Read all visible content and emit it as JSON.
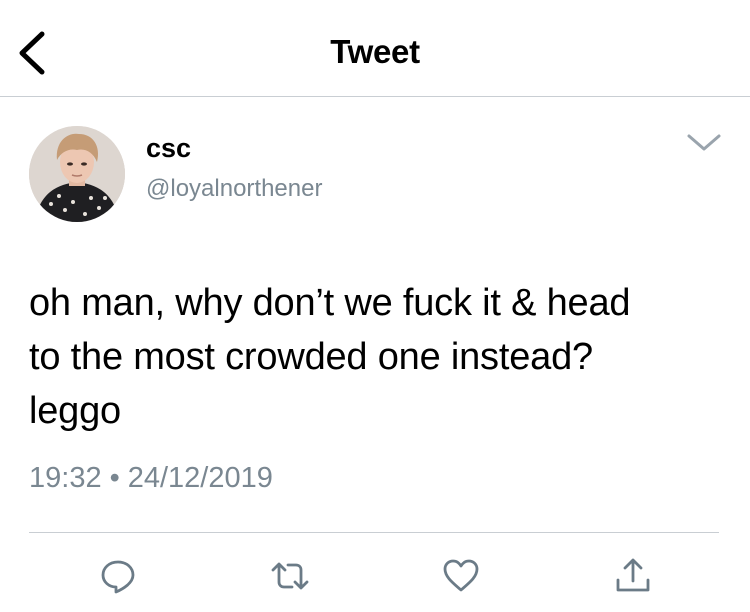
{
  "header": {
    "title": "Tweet",
    "back_icon": "chevron-left-icon"
  },
  "tweet": {
    "author": {
      "display_name": "csc",
      "handle": "@loyalnorthener",
      "avatar": "profile-photo"
    },
    "menu_icon": "chevron-down-icon",
    "text_lines": [
      "oh man, why don’t we fuck it & head",
      "to the most crowded one instead?",
      "leggo"
    ],
    "time": "19:32",
    "separator": "•",
    "date": "24/12/2019"
  },
  "actions": [
    {
      "name": "reply",
      "icon": "reply-icon"
    },
    {
      "name": "retweet",
      "icon": "retweet-icon"
    },
    {
      "name": "like",
      "icon": "heart-icon"
    },
    {
      "name": "share",
      "icon": "share-icon"
    }
  ],
  "colors": {
    "text": "#000000",
    "secondary": "#7a8791",
    "divider": "#c9ced3",
    "icon": "#6b7b87"
  }
}
